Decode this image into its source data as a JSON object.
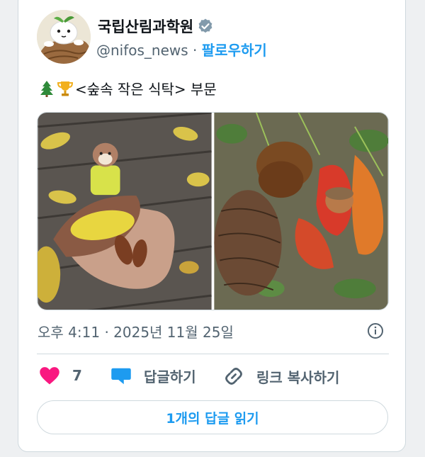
{
  "author": {
    "name": "국립산림과학원",
    "handle": "@nifos_news",
    "separator": "·",
    "follow_label": "팔로우하기"
  },
  "tweet": {
    "text": "<숲속 작은 식탁> 부문",
    "emoji": [
      "evergreen-tree",
      "trophy"
    ]
  },
  "media": {
    "photos": [
      {
        "subject": "toy squirrel figurine with yellow leaf and pine cones on a ceramic leaf plate"
      },
      {
        "subject": "acorn, chestnut and red autumn leaves on pine cones"
      }
    ]
  },
  "meta": {
    "time": "오후 4:11",
    "separator": "·",
    "date": "2025년 11월 25일"
  },
  "actions": {
    "like_count": "7",
    "reply_label": "답글하기",
    "copy_link_label": "링크 복사하기"
  },
  "read_replies_label": "1개의 답글 읽기",
  "colors": {
    "accent": "#1d9bf0",
    "like": "#f91880",
    "secondary_text": "#536471",
    "primary_text": "#0f1419",
    "border": "#cfd9de"
  }
}
